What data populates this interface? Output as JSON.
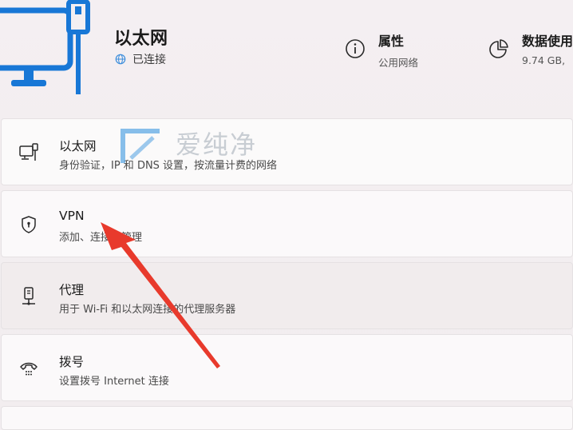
{
  "header": {
    "title": "以太网",
    "status": "已连接",
    "properties": {
      "title": "属性",
      "subtitle": "公用网络"
    },
    "data_usage": {
      "title": "数据使用",
      "subtitle": "9.74 GB,"
    }
  },
  "cards": [
    {
      "title": "以太网",
      "subtitle": "身份验证，IP 和 DNS 设置，按流量计费的网络",
      "icon": "ethernet-icon"
    },
    {
      "title": "VPN",
      "subtitle": "添加、连接、管理",
      "icon": "shield-icon"
    },
    {
      "title": "代理",
      "subtitle": "用于 Wi-Fi 和以太网连接的代理服务器",
      "icon": "proxy-server-icon"
    },
    {
      "title": "拨号",
      "subtitle": "设置拨号 Internet 连接",
      "icon": "dial-up-phone-icon"
    }
  ],
  "watermark": {
    "text": "爱纯净"
  },
  "colors": {
    "accent": "#1a73d9",
    "annotation": "#e83a2c"
  }
}
